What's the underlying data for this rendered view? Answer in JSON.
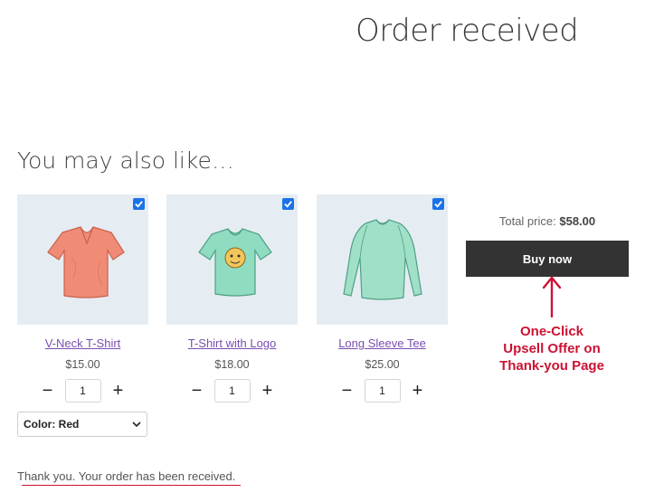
{
  "page": {
    "title": "Order received",
    "section_title": "You may also like…",
    "thank_you": "Thank you. Your order has been received."
  },
  "products": [
    {
      "name": "V-Neck T-Shirt",
      "price": "$15.00",
      "quantity": "1",
      "checked": true,
      "image_icon": "vneck-tshirt-image",
      "shirt_color": "#f08c76"
    },
    {
      "name": "T-Shirt with Logo",
      "price": "$18.00",
      "quantity": "1",
      "checked": true,
      "image_icon": "logo-tshirt-image",
      "shirt_color": "#8fdcc0"
    },
    {
      "name": "Long Sleeve Tee",
      "price": "$25.00",
      "quantity": "1",
      "checked": true,
      "image_icon": "long-sleeve-tee-image",
      "shirt_color": "#9fe0c6"
    }
  ],
  "variation": {
    "selected": "Color: Red"
  },
  "summary": {
    "total_label": "Total price:",
    "total_value": "$58.00",
    "buy_label": "Buy now"
  },
  "annotation": {
    "line1": "One-Click",
    "line2": "Upsell Offer on",
    "line3": "Thank-you Page",
    "color": "#cc1233"
  },
  "qty_controls": {
    "minus": "−",
    "plus": "+"
  }
}
